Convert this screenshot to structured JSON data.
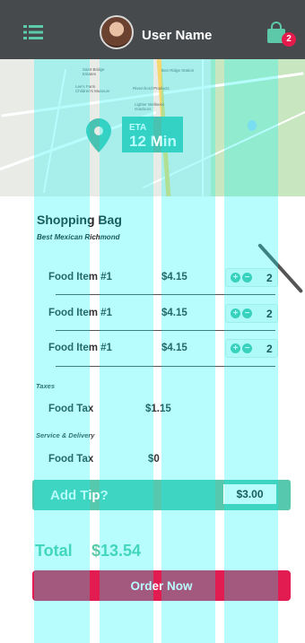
{
  "header": {
    "user_name": "User Name",
    "cart_count": "2",
    "menu_icon": "hamburger-menu-icon",
    "bag_icon": "shopping-bag-icon",
    "bg_color": "#464a4d"
  },
  "map": {
    "eta_label": "ETA",
    "eta_value": "12 Min",
    "pin_icon": "location-pin-icon",
    "accent_color": "#49c2b2"
  },
  "bag": {
    "title": "Shopping Bag",
    "restaurant": "Best Mexican Richmond",
    "items": [
      {
        "name": "Food Item #1",
        "price": "$4.15",
        "qty": "2"
      },
      {
        "name": "Food Item #1",
        "price": "$4.15",
        "qty": "2"
      },
      {
        "name": "Food Item #1",
        "price": "$4.15",
        "qty": "2"
      }
    ],
    "taxes_label": "Taxes",
    "tax": {
      "name": "Food Tax",
      "value": "$1.15"
    },
    "service_label": "Service & Delivery",
    "service": {
      "name": "Food Tax",
      "value": "$0"
    }
  },
  "tip": {
    "label": "Add Tip?",
    "value": "$3.00",
    "color": "#56c8ae"
  },
  "total": {
    "label": "Total",
    "value": "$13.54"
  },
  "order_button": {
    "label": "Order Now",
    "color": "#e21c50"
  }
}
